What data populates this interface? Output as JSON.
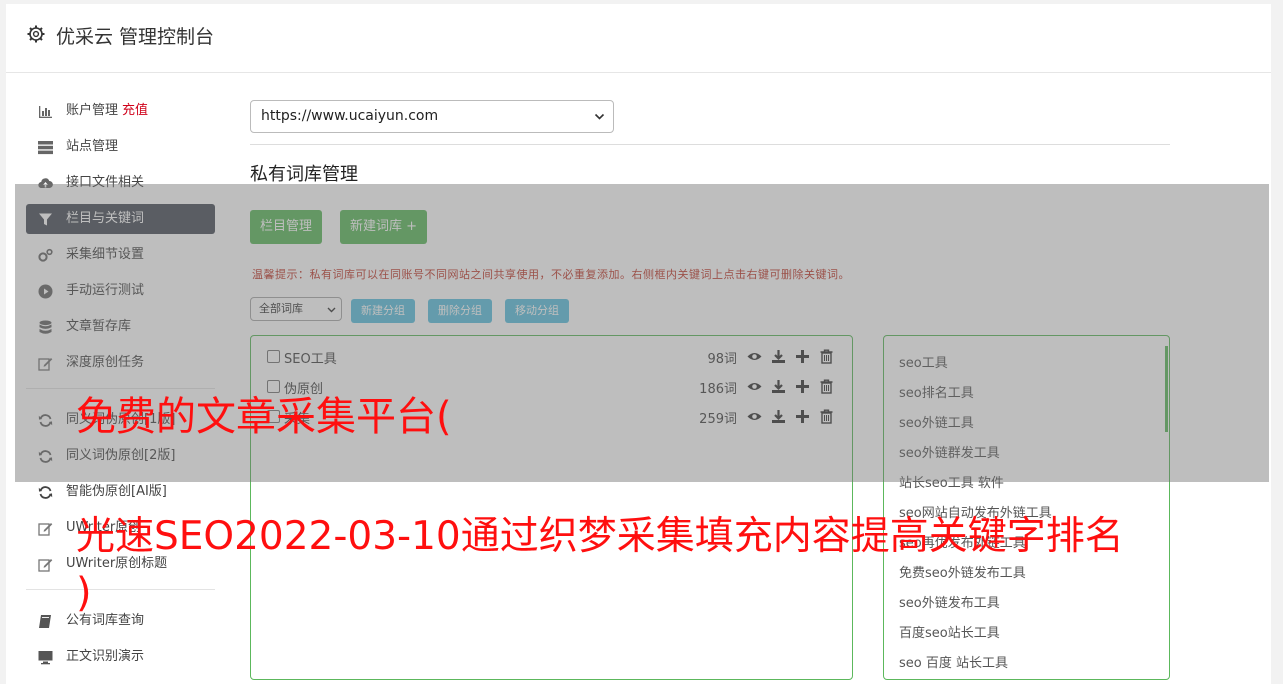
{
  "app": {
    "title": "优采云 管理控制台",
    "icon": "gear-icon"
  },
  "sidebar": {
    "items": [
      {
        "label": "账户管理",
        "tag": "充值",
        "icon": "bar-chart-icon",
        "active": false
      },
      {
        "label": "站点管理",
        "icon": "server-icon",
        "active": false
      },
      {
        "label": "接口文件相关",
        "icon": "cloud-upload-icon",
        "active": false
      },
      {
        "label": "栏目与关键词",
        "icon": "filter-icon",
        "active": true
      },
      {
        "label": "采集细节设置",
        "icon": "cogs-icon",
        "active": false
      },
      {
        "label": "手动运行测试",
        "icon": "play-circle-icon",
        "active": false
      },
      {
        "label": "文章暂存库",
        "icon": "database-icon",
        "active": false
      },
      {
        "label": "深度原创任务",
        "icon": "edit-icon",
        "active": false
      },
      {
        "label": "同义词伪原创[1版]",
        "icon": "refresh-icon",
        "active": false
      },
      {
        "label": "同义词伪原创[2版]",
        "icon": "refresh-icon",
        "active": false
      },
      {
        "label": "智能伪原创[AI版]",
        "icon": "refresh-icon",
        "active": false
      },
      {
        "label": "UWriter原创",
        "icon": "edit-icon",
        "active": false
      },
      {
        "label": "UWriter原创标题",
        "icon": "edit-icon",
        "active": false
      },
      {
        "label": "公有词库查询",
        "icon": "book-icon",
        "active": false
      },
      {
        "label": "正文识别演示",
        "icon": "monitor-icon",
        "active": false
      }
    ]
  },
  "main": {
    "site_select": {
      "value": "https://www.ucaiyun.com"
    },
    "section_title": "私有词库管理",
    "buttons": {
      "columns": "栏目管理",
      "new_library": "新建词库 +"
    },
    "tip": "温馨提示：私有词库可以在同账号不同网站之间共享使用，不必重复添加。右侧框内关键词上点击右键可删除关键词。",
    "library_filter": {
      "value": "全部词库"
    },
    "group_buttons": {
      "new": "新建分组",
      "delete": "删除分组",
      "move": "移动分组"
    },
    "groups": [
      {
        "name": "SEO工具",
        "count": "98词"
      },
      {
        "name": "伪原创",
        "count": "186词"
      },
      {
        "name": "采集",
        "count": "259词"
      }
    ],
    "keywords": [
      "seo工具",
      "seo排名工具",
      "seo外链工具",
      "seo外链群发工具",
      "站长seo工具 软件",
      "seo网站自动发布外链工具",
      "seo再优发布外链工具",
      "免费seo外链发布工具",
      "seo外链发布工具",
      "百度seo站长工具",
      "seo 百度 站长工具"
    ]
  },
  "watermark": {
    "line1": "免费的文章采集平台(",
    "line2": "光速SEO2022-03-10通过织梦采集填充内容提高关键字排名",
    "line3": ")"
  },
  "colors": {
    "green": "#5cb85c",
    "blue": "#5bc0de",
    "active_nav": "#4a4f59",
    "watermark": "#ff0f0f",
    "tip": "#c0392b"
  }
}
